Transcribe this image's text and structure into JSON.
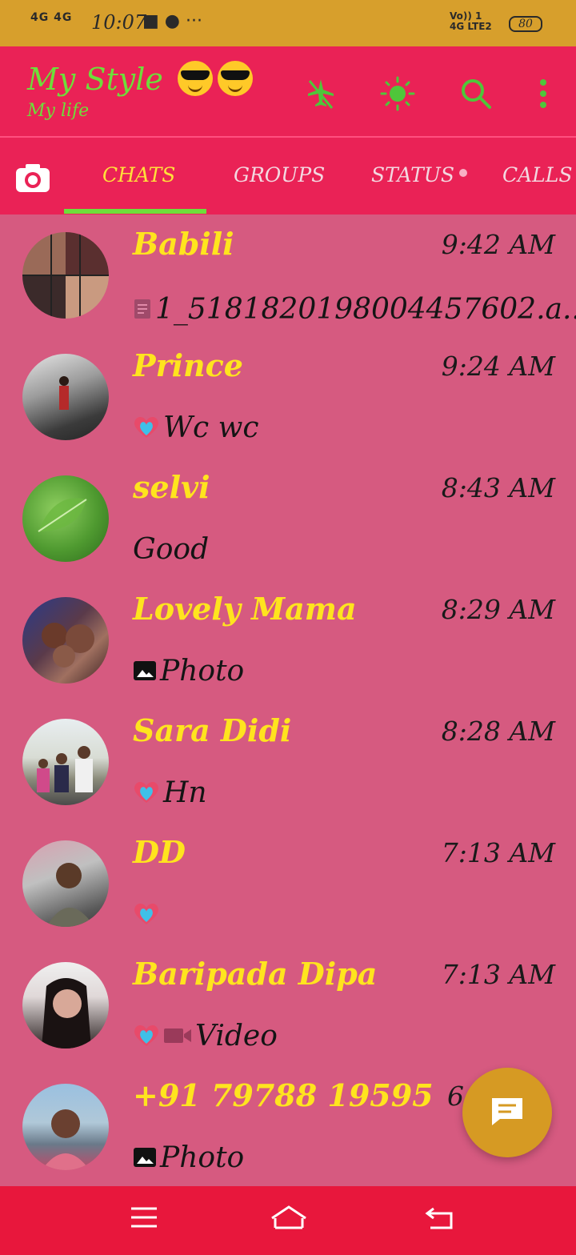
{
  "status_bar": {
    "signal": "4G 4G",
    "time": "10:07",
    "icons": "■ ● ···",
    "network": "Vo)) 1 4G LTE2",
    "battery": "80"
  },
  "header": {
    "title": "My Style",
    "subtitle": "My life",
    "icons": [
      "airplane-mode-icon",
      "brightness-icon",
      "search-icon",
      "more-vert-icon"
    ],
    "accent_color": "#6ede3a"
  },
  "tabs": [
    {
      "label": "CHATS",
      "active": true
    },
    {
      "label": "GROUPS",
      "active": false
    },
    {
      "label": "STATUS",
      "active": false
    },
    {
      "label": "CALLS",
      "active": false
    }
  ],
  "chats": [
    {
      "name": "Babili",
      "time": "9:42 AM",
      "preview": "1_518182019800445760​2.a...",
      "preview_icon": "document-icon"
    },
    {
      "name": "Prince",
      "time": "9:24 AM",
      "preview": "Wc wc",
      "preview_icon": "heart-emoji-icon"
    },
    {
      "name": "selvi",
      "time": "8:43 AM",
      "preview": "Good",
      "preview_icon": ""
    },
    {
      "name": "Lovely Mama",
      "time": "8:29 AM",
      "preview": "Photo",
      "preview_icon": "photo-icon"
    },
    {
      "name": "Sara Didi",
      "time": "8:28 AM",
      "preview": "Hn",
      "preview_icon": "heart-emoji-icon"
    },
    {
      "name": "DD",
      "time": "7:13 AM",
      "preview": "",
      "preview_icon": "heart-emoji-icon"
    },
    {
      "name": "Baripada Dipa",
      "time": "7:13 AM",
      "preview": "Video",
      "preview_icon": "heart-video-icon"
    },
    {
      "name": "+91 79788 19595",
      "time": "6",
      "preview": "Photo",
      "preview_icon": "photo-icon"
    }
  ],
  "colors": {
    "status_bar": "#d79f2c",
    "header": "#ea2256",
    "list_background": "#d65a80",
    "name_text": "#ffe41e",
    "fab": "#d69a23",
    "nav_bar": "#e8173c"
  },
  "fab_icon": "new-chat-icon",
  "nav_icons": [
    "menu-icon",
    "home-icon",
    "back-icon"
  ]
}
